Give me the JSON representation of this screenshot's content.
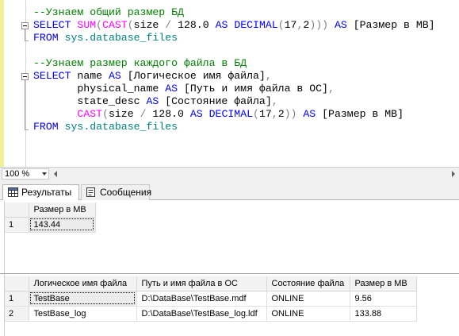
{
  "editor": {
    "lines": [
      {
        "parts": [
          {
            "t": "--Узнаем общий размер БД",
            "c": "c"
          }
        ]
      },
      {
        "parts": [
          {
            "t": "SELECT ",
            "c": "k"
          },
          {
            "t": "SUM",
            "c": "f"
          },
          {
            "t": "(",
            "c": "g"
          },
          {
            "t": "CAST",
            "c": "f"
          },
          {
            "t": "(",
            "c": "g"
          },
          {
            "t": "size ",
            "c": ""
          },
          {
            "t": "/",
            "c": "g"
          },
          {
            "t": " 128.0 ",
            "c": ""
          },
          {
            "t": "AS",
            "c": "k"
          },
          {
            "t": " ",
            "c": ""
          },
          {
            "t": "DECIMAL",
            "c": "k"
          },
          {
            "t": "(",
            "c": "g"
          },
          {
            "t": "17",
            "c": ""
          },
          {
            "t": ",",
            "c": "g"
          },
          {
            "t": "2",
            "c": ""
          },
          {
            "t": ")))",
            "c": "g"
          },
          {
            "t": " AS ",
            "c": "k"
          },
          {
            "t": "[Размер в МВ]",
            "c": ""
          }
        ]
      },
      {
        "parts": [
          {
            "t": "FROM ",
            "c": "k"
          },
          {
            "t": "sys.database_files",
            "c": "s"
          }
        ]
      },
      {
        "parts": []
      },
      {
        "parts": [
          {
            "t": "--Узнаем размер каждого файла в БД",
            "c": "c"
          }
        ]
      },
      {
        "parts": [
          {
            "t": "SELECT ",
            "c": "k"
          },
          {
            "t": "name ",
            "c": ""
          },
          {
            "t": "AS",
            "c": "k"
          },
          {
            "t": " [Логическое имя файла]",
            "c": ""
          },
          {
            "t": ",",
            "c": "g"
          }
        ]
      },
      {
        "parts": [
          {
            "t": "       physical_name ",
            "c": ""
          },
          {
            "t": "AS",
            "c": "k"
          },
          {
            "t": " [Путь и имя файла в ОС]",
            "c": ""
          },
          {
            "t": ",",
            "c": "g"
          }
        ]
      },
      {
        "parts": [
          {
            "t": "       state_desc ",
            "c": ""
          },
          {
            "t": "AS",
            "c": "k"
          },
          {
            "t": " [Состояние файла]",
            "c": ""
          },
          {
            "t": ",",
            "c": "g"
          }
        ]
      },
      {
        "parts": [
          {
            "t": "       ",
            "c": ""
          },
          {
            "t": "CAST",
            "c": "f"
          },
          {
            "t": "(",
            "c": "g"
          },
          {
            "t": "size ",
            "c": ""
          },
          {
            "t": "/",
            "c": "g"
          },
          {
            "t": " 128.0 ",
            "c": ""
          },
          {
            "t": "AS",
            "c": "k"
          },
          {
            "t": " ",
            "c": ""
          },
          {
            "t": "DECIMAL",
            "c": "k"
          },
          {
            "t": "(",
            "c": "g"
          },
          {
            "t": "17",
            "c": ""
          },
          {
            "t": ",",
            "c": "g"
          },
          {
            "t": "2",
            "c": ""
          },
          {
            "t": "))",
            "c": "g"
          },
          {
            "t": " AS ",
            "c": "k"
          },
          {
            "t": "[Размер в МВ]",
            "c": ""
          }
        ]
      },
      {
        "parts": [
          {
            "t": "FROM ",
            "c": "k"
          },
          {
            "t": "sys.database_files",
            "c": "s"
          }
        ]
      }
    ]
  },
  "zoom": {
    "value": "100 %"
  },
  "tabs": {
    "results": "Результаты",
    "messages": "Сообщения"
  },
  "grid1": {
    "headers": [
      "Размер в МВ"
    ],
    "rows": [
      {
        "n": "1",
        "cells": [
          "143.44"
        ]
      }
    ]
  },
  "grid2": {
    "headers": [
      "Логическое имя файла",
      "Путь и имя файла в ОС",
      "Состояние файла",
      "Размер в МВ"
    ],
    "rows": [
      {
        "n": "1",
        "cells": [
          "TestBase",
          "D:\\DataBase\\TestBase.mdf",
          "ONLINE",
          "9.56"
        ]
      },
      {
        "n": "2",
        "cells": [
          "TestBase_log",
          "D:\\DataBase\\TestBase_log.ldf",
          "ONLINE",
          "133.88"
        ]
      }
    ]
  }
}
